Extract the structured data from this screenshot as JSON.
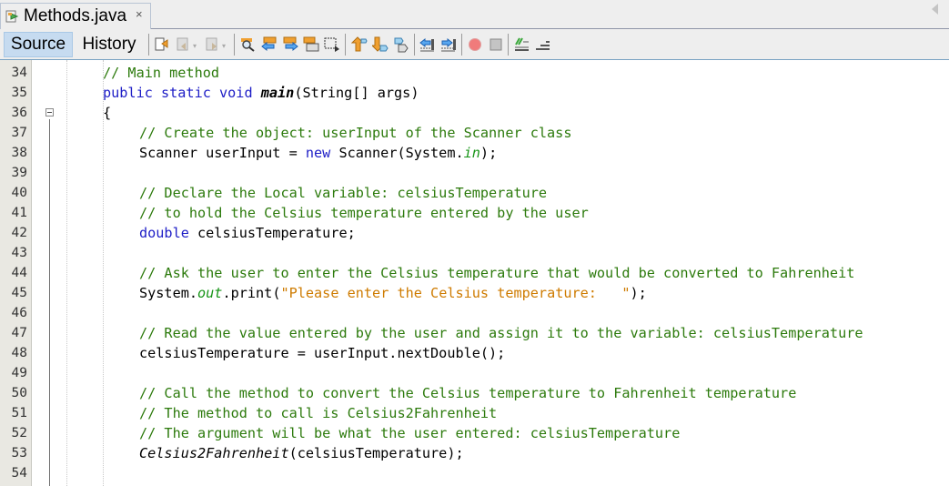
{
  "tab": {
    "title": "Methods.java",
    "close": "×",
    "icon": "java-file-icon"
  },
  "toolbar": {
    "source_label": "Source",
    "history_label": "History",
    "icons": [
      "last-edit-icon",
      "back-icon",
      "forward-icon",
      "find-selection-icon",
      "find-previous-icon",
      "find-next-icon",
      "toggle-highlight-icon",
      "toggle-rect-selection-icon",
      "previous-bookmark-icon",
      "next-bookmark-icon",
      "toggle-bookmark-icon",
      "shift-left-icon",
      "shift-right-icon",
      "record-macro-icon",
      "stop-macro-icon",
      "comment-icon",
      "uncomment-icon"
    ]
  },
  "colors": {
    "comment": "#2c7a0c",
    "keyword": "#1d1dc6",
    "string": "#ce7b00",
    "static_field": "#169416",
    "gutter": "#e9e8e2"
  },
  "lines": [
    {
      "n": "34",
      "indent": 0,
      "tokens": [
        {
          "t": "// Main method",
          "c": "cm"
        }
      ]
    },
    {
      "n": "35",
      "indent": 0,
      "tokens": [
        {
          "t": "public static void ",
          "c": "kw"
        },
        {
          "t": "main",
          "c": "bi"
        },
        {
          "t": "(String[] args)",
          "c": "pl"
        }
      ]
    },
    {
      "n": "36",
      "indent": 0,
      "tokens": [
        {
          "t": "{",
          "c": "pl"
        }
      ]
    },
    {
      "n": "37",
      "indent": 1,
      "tokens": [
        {
          "t": "// Create the object: userInput of the Scanner class",
          "c": "cm"
        }
      ]
    },
    {
      "n": "38",
      "indent": 1,
      "tokens": [
        {
          "t": "Scanner userInput = ",
          "c": "pl"
        },
        {
          "t": "new",
          "c": "kw"
        },
        {
          "t": " Scanner(System.",
          "c": "pl"
        },
        {
          "t": "in",
          "c": "itg"
        },
        {
          "t": ");",
          "c": "pl"
        }
      ]
    },
    {
      "n": "39",
      "indent": 1,
      "tokens": []
    },
    {
      "n": "40",
      "indent": 1,
      "tokens": [
        {
          "t": "// Declare the Local variable: celsiusTemperature",
          "c": "cm"
        }
      ]
    },
    {
      "n": "41",
      "indent": 1,
      "tokens": [
        {
          "t": "// to hold the Celsius temperature entered by the user",
          "c": "cm"
        }
      ]
    },
    {
      "n": "42",
      "indent": 1,
      "tokens": [
        {
          "t": "double",
          "c": "kw"
        },
        {
          "t": " celsiusTemperature;",
          "c": "pl"
        }
      ]
    },
    {
      "n": "43",
      "indent": 1,
      "tokens": []
    },
    {
      "n": "44",
      "indent": 1,
      "tokens": [
        {
          "t": "// Ask the user to enter the Celsius temperature that would be converted to Fahrenheit",
          "c": "cm"
        }
      ]
    },
    {
      "n": "45",
      "indent": 1,
      "tokens": [
        {
          "t": "System.",
          "c": "pl"
        },
        {
          "t": "out",
          "c": "itg"
        },
        {
          "t": ".print(",
          "c": "pl"
        },
        {
          "t": "\"Please enter the Celsius temperature:   \"",
          "c": "st"
        },
        {
          "t": ");",
          "c": "pl"
        }
      ]
    },
    {
      "n": "46",
      "indent": 1,
      "tokens": []
    },
    {
      "n": "47",
      "indent": 1,
      "tokens": [
        {
          "t": "// Read the value entered by the user and assign it to the variable: celsiusTemperature",
          "c": "cm"
        }
      ]
    },
    {
      "n": "48",
      "indent": 1,
      "tokens": [
        {
          "t": "celsiusTemperature = userInput.nextDouble();",
          "c": "pl"
        }
      ]
    },
    {
      "n": "49",
      "indent": 1,
      "tokens": []
    },
    {
      "n": "50",
      "indent": 1,
      "tokens": [
        {
          "t": "// Call the method to convert the Celsius temperature to Fahrenheit temperature",
          "c": "cm"
        }
      ]
    },
    {
      "n": "51",
      "indent": 1,
      "tokens": [
        {
          "t": "// The method to call is Celsius2Fahrenheit",
          "c": "cm"
        }
      ]
    },
    {
      "n": "52",
      "indent": 1,
      "tokens": [
        {
          "t": "// The argument will be what the user entered: celsiusTemperature",
          "c": "cm"
        }
      ]
    },
    {
      "n": "53",
      "indent": 1,
      "tokens": [
        {
          "t": "Celsius2Fahrenheit",
          "c": "it"
        },
        {
          "t": "(celsiusTemperature);",
          "c": "pl"
        }
      ]
    },
    {
      "n": "54",
      "indent": 1,
      "tokens": []
    }
  ]
}
